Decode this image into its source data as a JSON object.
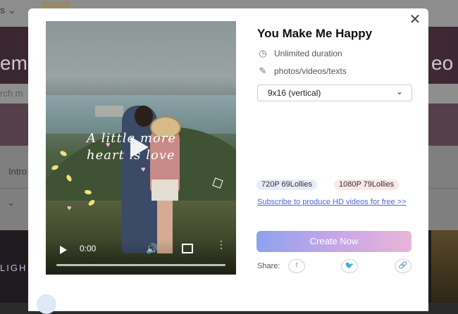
{
  "background": {
    "hero_left": "em",
    "hero_right": "eo",
    "search_placeholder": "rch m",
    "intro_tab": "Intro",
    "bottom_left": "LIGH"
  },
  "modal": {
    "title": "You Make Me Happy",
    "features": [
      {
        "icon": "clock-icon",
        "text": "Unlimited duration"
      },
      {
        "icon": "pencil-icon",
        "text": "photos/videos/texts"
      }
    ],
    "ratio_select": {
      "value": "9x16 (vertical)"
    },
    "prices": [
      {
        "label": "720P 69Lollies"
      },
      {
        "label": "1080P 79Lollies"
      }
    ],
    "subscribe_link": "Subscribe to produce HD videos for free >>",
    "create_button": "Create Now",
    "share_label": "Share:",
    "share_icons": [
      "facebook-icon",
      "twitter-icon",
      "link-icon"
    ]
  },
  "video": {
    "overlay_text_line1": "A little more",
    "overlay_text_line2": "heart is love",
    "current_time": "0:00",
    "progress": 0
  }
}
